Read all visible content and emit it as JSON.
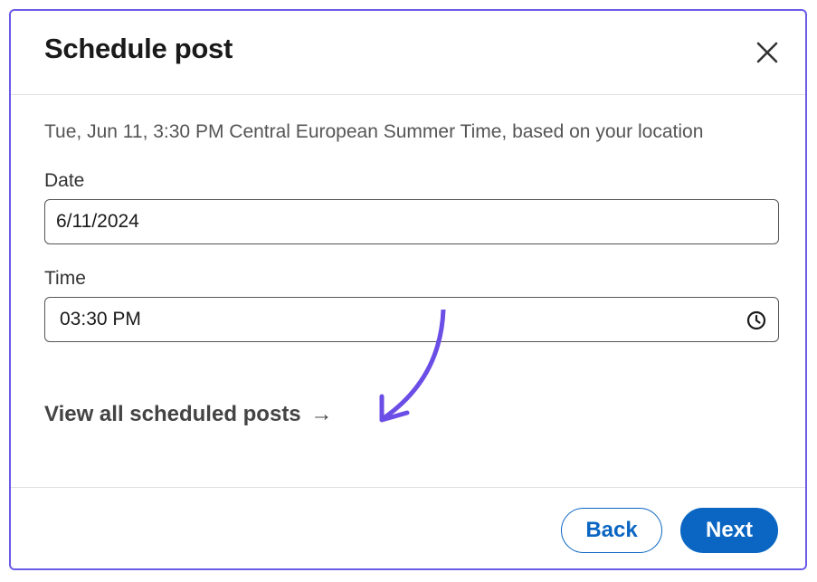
{
  "dialog": {
    "title": "Schedule post",
    "close_icon": "close-icon",
    "timezone_note": "Tue, Jun 11, 3:30 PM Central European Summer Time, based on your location"
  },
  "date_field": {
    "label": "Date",
    "value": "6/11/2024"
  },
  "time_field": {
    "label": "Time",
    "value": "03:30 PM",
    "icon": "clock-icon"
  },
  "links": {
    "view_scheduled": "View all scheduled posts",
    "view_scheduled_arrow": "→"
  },
  "footer": {
    "back_label": "Back",
    "next_label": "Next"
  },
  "colors": {
    "accent": "#0a66c2",
    "frame": "#6b5ce7",
    "annotation": "#6b4ee6"
  }
}
